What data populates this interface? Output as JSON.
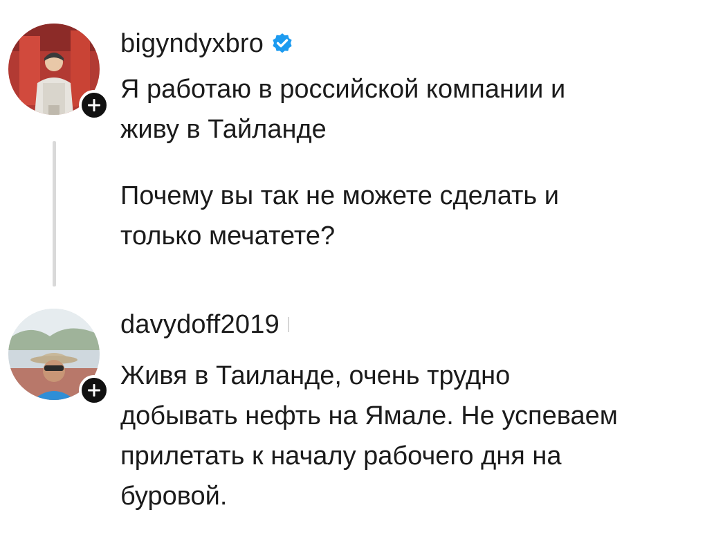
{
  "comments": [
    {
      "username": "bigyndyxbro",
      "verified": true,
      "avatar_icon": "user-avatar-photo",
      "follow_icon": "plus-icon",
      "paragraphs": [
        [
          "Я работаю в российской компании и",
          "живу в Тайланде"
        ],
        [
          "Почему вы так не можете сделать и",
          "только мечатете?"
        ]
      ]
    },
    {
      "username": "davydoff2019",
      "verified": false,
      "avatar_icon": "user-avatar-photo",
      "follow_icon": "plus-icon",
      "paragraphs": [
        [
          "Живя в Таиланде, очень трудно",
          "добывать нефть на Ямале. Не успеваем",
          "прилетать к началу рабочего дня на",
          "буровой."
        ]
      ]
    }
  ],
  "colors": {
    "verified": "#1d9bf0",
    "badge": "#111111",
    "thread_line": "#d9d9d9",
    "text": "#1b1b1b"
  }
}
